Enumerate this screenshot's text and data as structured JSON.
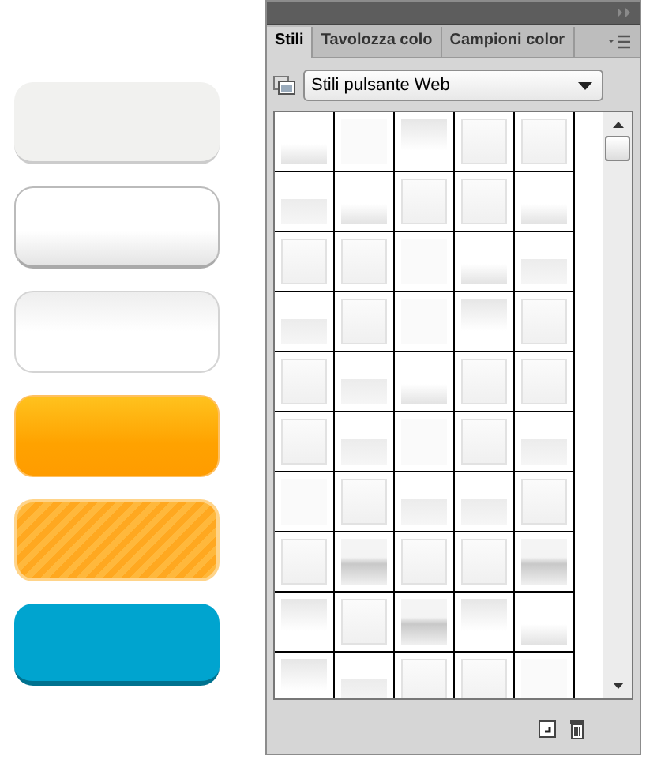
{
  "buttons": [
    {
      "kind": "grey"
    },
    {
      "kind": "white-glossy"
    },
    {
      "kind": "white-soft"
    },
    {
      "kind": "orange"
    },
    {
      "kind": "orange-striped"
    },
    {
      "kind": "blue"
    }
  ],
  "panel": {
    "tabs": [
      {
        "label": "Stili",
        "selected": true
      },
      {
        "label": "Tavolozza colo",
        "selected": false
      },
      {
        "label": "Campioni color",
        "selected": false
      }
    ],
    "preset": {
      "value": "Stili pulsante Web"
    },
    "swatches": [
      {
        "kind": "shade-bottom"
      },
      {
        "kind": "plain"
      },
      {
        "kind": "shade-top"
      },
      {
        "kind": "frame"
      },
      {
        "kind": "frame"
      },
      {
        "kind": "band"
      },
      {
        "kind": "shade-bottom"
      },
      {
        "kind": "frame"
      },
      {
        "kind": "frame"
      },
      {
        "kind": "shade-bottom"
      },
      {
        "kind": "frame"
      },
      {
        "kind": "frame"
      },
      {
        "kind": "plain"
      },
      {
        "kind": "shade-bottom"
      },
      {
        "kind": "band"
      },
      {
        "kind": "band"
      },
      {
        "kind": "frame"
      },
      {
        "kind": "plain"
      },
      {
        "kind": "shade-top"
      },
      {
        "kind": "frame"
      },
      {
        "kind": "frame"
      },
      {
        "kind": "band"
      },
      {
        "kind": "shade-bottom"
      },
      {
        "kind": "frame"
      },
      {
        "kind": "frame"
      },
      {
        "kind": "frame"
      },
      {
        "kind": "band"
      },
      {
        "kind": "plain"
      },
      {
        "kind": "frame"
      },
      {
        "kind": "band"
      },
      {
        "kind": "plain"
      },
      {
        "kind": "frame"
      },
      {
        "kind": "band"
      },
      {
        "kind": "band"
      },
      {
        "kind": "frame"
      },
      {
        "kind": "frame"
      },
      {
        "kind": "dark"
      },
      {
        "kind": "frame"
      },
      {
        "kind": "frame"
      },
      {
        "kind": "dark"
      },
      {
        "kind": "shade-top"
      },
      {
        "kind": "frame"
      },
      {
        "kind": "dark"
      },
      {
        "kind": "shade-top"
      },
      {
        "kind": "shade-bottom"
      },
      {
        "kind": "shade-top"
      },
      {
        "kind": "band"
      },
      {
        "kind": "frame"
      },
      {
        "kind": "frame"
      },
      {
        "kind": "plain"
      }
    ]
  }
}
